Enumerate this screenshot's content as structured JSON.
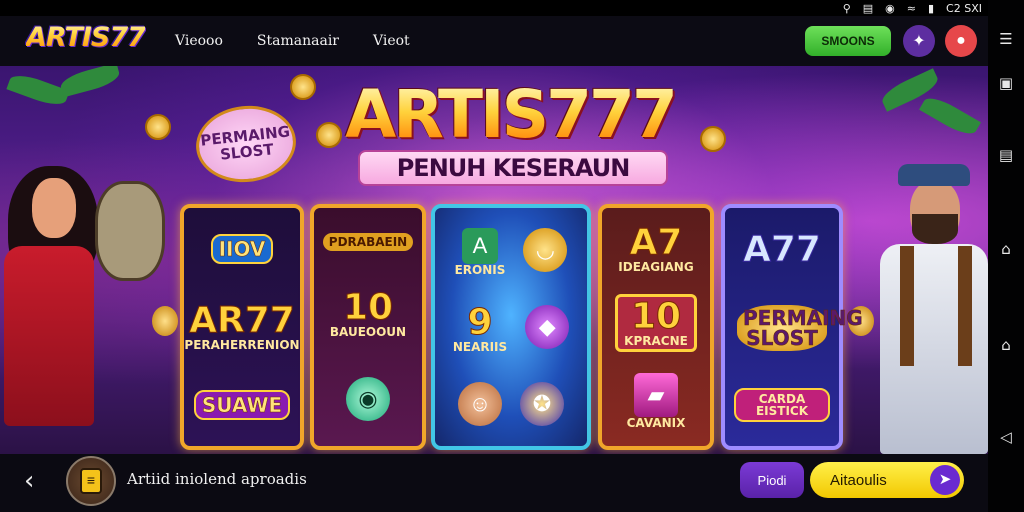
{
  "status_bar": {
    "icons": [
      "location-icon",
      "vibrate-icon",
      "alarm-icon",
      "wifi-icon",
      "signal-icon"
    ],
    "time": "C2 SXI"
  },
  "header": {
    "logo": "ARTIS77",
    "nav": [
      "Vieooo",
      "Stamanaair",
      "Vieot"
    ],
    "cta_label": "SMOONS",
    "cta_color": "#4cc23a",
    "icon_button_1": "star-icon",
    "icon_button_2": "avatar-icon"
  },
  "hero": {
    "title": "ARTIS777",
    "subtitle": "PENUH KESERAUN",
    "badge": "PERMAING SLOST",
    "reels": [
      {
        "top": "IIOV",
        "middle": "AR77",
        "middle_sub": "PERAHERRENION",
        "bottom": "SUAWE"
      },
      {
        "top": "PDRABAEIN",
        "middle": "10",
        "middle_sub": "BAUEOOUN",
        "bottom": ""
      },
      {
        "top": "ERONIS",
        "middle": "9",
        "middle_sub": "NEARIIS",
        "bottom": ""
      },
      {
        "top": "A7",
        "top_sub": "IDEAGIANG",
        "middle": "10",
        "middle_sub": "KPRACNE",
        "bottom": "CAVANIX"
      },
      {
        "top": "A77",
        "middle": "PERMAING SLOST",
        "bottom": "CARDA EISTICK"
      }
    ]
  },
  "bottom_bar": {
    "text": "Artiid iniolend aproadis",
    "button_1": "Piodi",
    "button_2": "Aitaoulis"
  },
  "system_nav": [
    "menu-icon",
    "multiwindow-icon",
    "home-icon",
    "recent-icon",
    "back-icon"
  ]
}
